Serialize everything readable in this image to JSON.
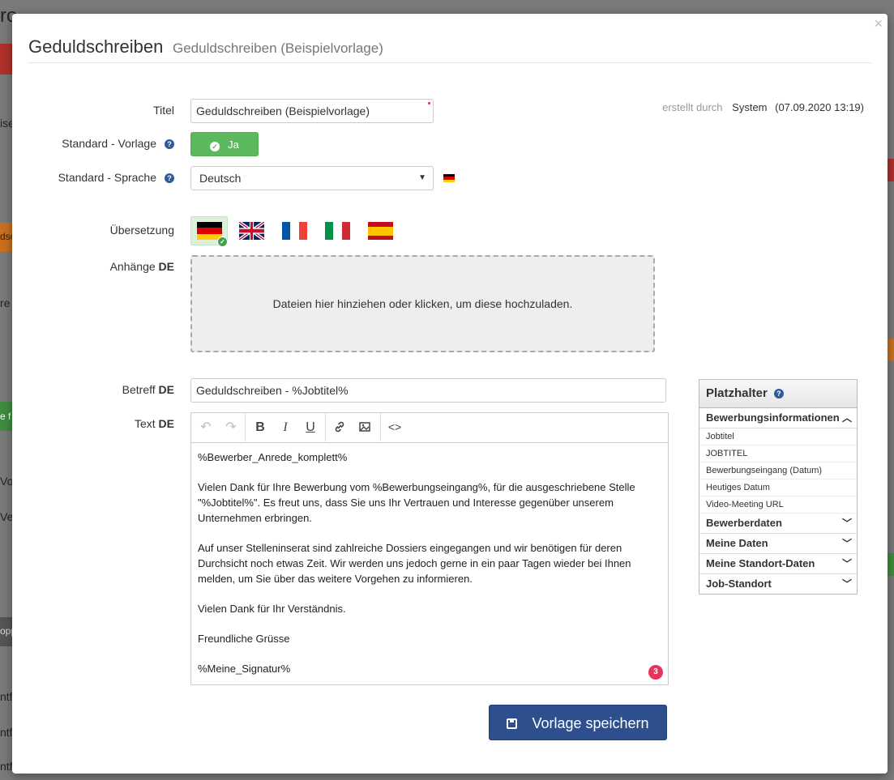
{
  "background": {
    "title_fragment": "ro",
    "rows": [
      "ise",
      "re",
      "e f",
      "Vo",
      "Ve",
      "ntf",
      "ntf",
      "ntf"
    ],
    "labels": [
      "dso",
      "opp"
    ]
  },
  "modal": {
    "title": "Geduldschreiben",
    "subtitle": "Geduldschreiben (Beispielvorlage)",
    "close": "×"
  },
  "form": {
    "titel_label": "Titel",
    "titel_value": "Geduldschreiben (Beispielvorlage)",
    "standard_vorlage_label": "Standard - Vorlage",
    "standard_vorlage_button": "Ja",
    "standard_sprache_label": "Standard - Sprache",
    "standard_sprache_value": "Deutsch",
    "uebersetzung_label": "Übersetzung",
    "anhaenge_label": "Anhänge",
    "lang_suffix": "DE",
    "dropzone_text": "Dateien hier hinziehen oder klicken, um diese hochzuladen.",
    "betreff_label": "Betreff",
    "betreff_value": "Geduldschreiben - %Jobtitel%",
    "text_label": "Text"
  },
  "meta": {
    "created_by_label": "erstellt durch",
    "created_by_value": "System",
    "created_date": "(07.09.2020 13:19)"
  },
  "editor": {
    "paragraphs": [
      "%Bewerber_Anrede_komplett%",
      "Vielen Dank für Ihre Bewerbung vom %Bewerbungseingang%, für die ausgeschriebene Stelle \"%Jobtitel%\". Es freut uns, dass Sie uns Ihr Vertrauen und Interesse gegenüber unserem Unternehmen erbringen.",
      "Auf unser Stelleninserat sind zahlreiche Dossiers eingegangen und wir benötigen für deren Durchsicht noch etwas Zeit. Wir werden uns jedoch gerne in ein paar Tagen wieder bei Ihnen melden, um Sie über das weitere Vorgehen zu informieren.",
      "Vielen Dank für Ihr Verständnis.",
      "Freundliche Grüsse",
      "%Meine_Signatur%"
    ],
    "badge_count": "3",
    "toolbar_icons": [
      "undo-icon",
      "redo-icon",
      "bold-icon",
      "italic-icon",
      "underline-icon",
      "link-icon",
      "image-icon",
      "code-icon"
    ]
  },
  "placeholders": {
    "title": "Platzhalter",
    "sections": [
      {
        "label": "Bewerbungsinformationen",
        "expanded": true,
        "items": [
          "Jobtitel",
          "JOBTITEL",
          "Bewerbungseingang (Datum)",
          "Heutiges Datum",
          "Video-Meeting URL"
        ]
      },
      {
        "label": "Bewerberdaten",
        "expanded": false
      },
      {
        "label": "Meine Daten",
        "expanded": false
      },
      {
        "label": "Meine Standort-Daten",
        "expanded": false
      },
      {
        "label": "Job-Standort",
        "expanded": false
      }
    ]
  },
  "save_button": "Vorlage speichern",
  "colors": {
    "success": "#5cb85c",
    "primary": "#2d4f8e",
    "badge": "#e8345a"
  }
}
